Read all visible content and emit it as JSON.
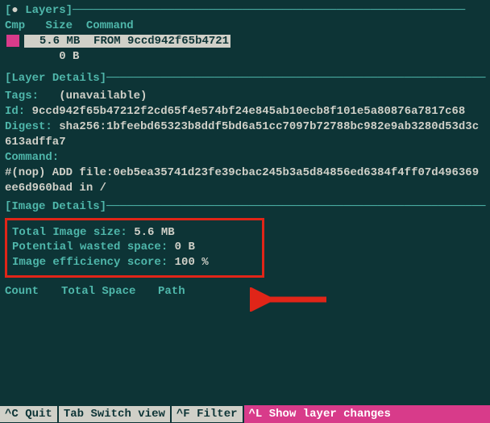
{
  "sections": {
    "layers_title": "Layers",
    "layer_details_title": "Layer Details",
    "image_details_title": "Image Details"
  },
  "layers_header": {
    "cmp": "Cmp",
    "size": "Size",
    "command": "Command"
  },
  "layers": {
    "row0": {
      "size": "5.6 MB",
      "command": "FROM 9ccd942f65b4721"
    },
    "row1": {
      "size": "0 B",
      "command": ""
    }
  },
  "layer_details": {
    "tags_label": "Tags:",
    "tags_value": "(unavailable)",
    "id_label": "Id:",
    "id_value": "9ccd942f65b47212f2cd65f4e574bf24e845ab10ecb8f101e5a80876a7817c68",
    "digest_label": "Digest:",
    "digest_value": "sha256:1bfeebd65323b8ddf5bd6a51cc7097b72788bc982e9ab3280d53d3c613adffa7",
    "command_label": "Command:",
    "command_value": "#(nop) ADD file:0eb5ea35741d23fe39cbac245b3a5d84856ed6384f4ff07d496369ee6d960bad in /"
  },
  "image_details": {
    "total_label": "Total Image size:",
    "total_value": "5.6 MB",
    "wasted_label": "Potential wasted space:",
    "wasted_value": "0 B",
    "efficiency_label": "Image efficiency score:",
    "efficiency_value": "100 %"
  },
  "table_header": {
    "count": "Count",
    "total_space": "Total Space",
    "path": "Path"
  },
  "statusbar": {
    "quit_key": "^C",
    "quit_label": "Quit",
    "switch_key": "Tab",
    "switch_label": "Switch view",
    "filter_key": "^F",
    "filter_label": "Filter",
    "changes_key": "^L",
    "changes_label": "Show layer changes"
  }
}
